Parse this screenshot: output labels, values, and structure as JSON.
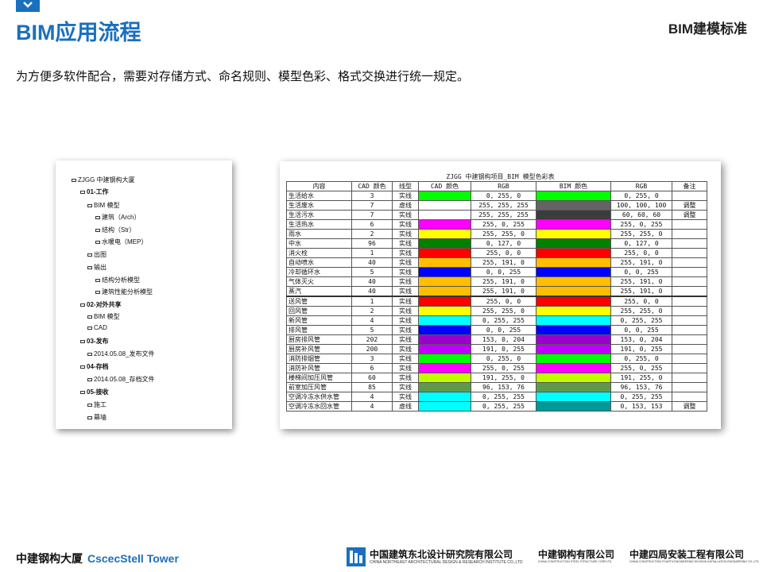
{
  "header": {
    "title": "BIM应用流程",
    "right_label": "BIM建模标准",
    "accent_color": "#1a6fbf"
  },
  "subtitle": "为方便多软件配合，需要对存储方式、命名规则、模型色彩、格式交换进行统一规定。",
  "folder_tree": [
    {
      "label": "ZJGG 中建钢构大厦",
      "bold": true
    },
    {
      "label": "01-工作",
      "bold": true
    },
    {
      "label": "BIM 模型",
      "bold": false
    },
    {
      "label": "建筑（Arch）",
      "bold": false
    },
    {
      "label": "结构（Str）",
      "bold": false
    },
    {
      "label": "水暖电（MEP）",
      "bold": false
    },
    {
      "label": "出图",
      "bold": false
    },
    {
      "label": "输出",
      "bold": false
    },
    {
      "label": "结构分析模型",
      "bold": false
    },
    {
      "label": "建筑性能分析模型",
      "bold": false
    },
    {
      "label": "02-对外共享",
      "bold": true
    },
    {
      "label": "BIM 模型",
      "bold": false
    },
    {
      "label": "CAD",
      "bold": false
    },
    {
      "label": "03-发布",
      "bold": true
    },
    {
      "label": "2014.05.08_发布文件",
      "bold": false
    },
    {
      "label": "04-存档",
      "bold": true
    },
    {
      "label": "2014.05.08_存档文件",
      "bold": false
    },
    {
      "label": "05-接收",
      "bold": true
    },
    {
      "label": "施工",
      "bold": false
    },
    {
      "label": "幕墙",
      "bold": false
    }
  ],
  "color_table": {
    "caption": "ZJGG 中建钢构项目_BIM 模型色彩表",
    "headers": [
      "内容",
      "CAD 颜色",
      "线型",
      "CAD 颜色",
      "RGB",
      "BIM 颜色",
      "RGB",
      "备注"
    ],
    "rows": [
      {
        "name": "生活给水",
        "cad": "3",
        "line": "实线",
        "cad_color": "#00ff00",
        "rgb1": "0, 255, 0",
        "bim_color": "#00ff00",
        "rgb2": "0, 255, 0",
        "note": ""
      },
      {
        "name": "生活废水",
        "cad": "7",
        "line": "虚线",
        "cad_color": "#ffffff",
        "rgb1": "255, 255, 255",
        "bim_color": "#646464",
        "rgb2": "100, 100, 100",
        "note": "调整"
      },
      {
        "name": "生活污水",
        "cad": "7",
        "line": "实线",
        "cad_color": "#ffffff",
        "rgb1": "255, 255, 255",
        "bim_color": "#3c3c3c",
        "rgb2": "60, 60, 60",
        "note": "调整"
      },
      {
        "name": "生活热水",
        "cad": "6",
        "line": "实线",
        "cad_color": "#ff00ff",
        "rgb1": "255, 0, 255",
        "bim_color": "#ff00ff",
        "rgb2": "255, 0, 255",
        "note": ""
      },
      {
        "name": "雨水",
        "cad": "2",
        "line": "实线",
        "cad_color": "#ffff00",
        "rgb1": "255, 255, 0",
        "bim_color": "#ffff00",
        "rgb2": "255, 255, 0",
        "note": ""
      },
      {
        "name": "中水",
        "cad": "96",
        "line": "实线",
        "cad_color": "#007f00",
        "rgb1": "0, 127, 0",
        "bim_color": "#007f00",
        "rgb2": "0, 127, 0",
        "note": ""
      },
      {
        "name": "消火栓",
        "cad": "1",
        "line": "实线",
        "cad_color": "#ff0000",
        "rgb1": "255, 0, 0",
        "bim_color": "#ff0000",
        "rgb2": "255, 0, 0",
        "note": ""
      },
      {
        "name": "自动喷水",
        "cad": "40",
        "line": "实线",
        "cad_color": "#ffbf00",
        "rgb1": "255, 191, 0",
        "bim_color": "#ffbf00",
        "rgb2": "255, 191, 0",
        "note": ""
      },
      {
        "name": "冷却循环水",
        "cad": "5",
        "line": "实线",
        "cad_color": "#0000ff",
        "rgb1": "0, 0, 255",
        "bim_color": "#0000ff",
        "rgb2": "0, 0, 255",
        "note": ""
      },
      {
        "name": "气体灭火",
        "cad": "40",
        "line": "实线",
        "cad_color": "#ffbf00",
        "rgb1": "255, 191, 0",
        "bim_color": "#ffbf00",
        "rgb2": "255, 191, 0",
        "note": ""
      },
      {
        "name": "蒸汽",
        "cad": "40",
        "line": "实线",
        "cad_color": "#ffbf00",
        "rgb1": "255, 191, 0",
        "bim_color": "#ffbf00",
        "rgb2": "255, 191, 0",
        "note": ""
      },
      {
        "name": "送风管",
        "cad": "1",
        "line": "实线",
        "cad_color": "#ff0000",
        "rgb1": "255, 0, 0",
        "bim_color": "#ff0000",
        "rgb2": "255, 0, 0",
        "note": ""
      },
      {
        "name": "回风管",
        "cad": "2",
        "line": "实线",
        "cad_color": "#ffff00",
        "rgb1": "255, 255, 0",
        "bim_color": "#ffff00",
        "rgb2": "255, 255, 0",
        "note": ""
      },
      {
        "name": "新风管",
        "cad": "4",
        "line": "实线",
        "cad_color": "#00ffff",
        "rgb1": "0, 255, 255",
        "bim_color": "#00ffff",
        "rgb2": "0, 255, 255",
        "note": ""
      },
      {
        "name": "排风管",
        "cad": "5",
        "line": "实线",
        "cad_color": "#0000ff",
        "rgb1": "0, 0, 255",
        "bim_color": "#0000ff",
        "rgb2": "0, 0, 255",
        "note": ""
      },
      {
        "name": "厨房排风管",
        "cad": "202",
        "line": "实线",
        "cad_color": "#9900cc",
        "rgb1": "153, 0, 204",
        "bim_color": "#9900cc",
        "rgb2": "153, 0, 204",
        "note": ""
      },
      {
        "name": "厨房补风管",
        "cad": "200",
        "line": "实线",
        "cad_color": "#bf00ff",
        "rgb1": "191, 0, 255",
        "bim_color": "#bf00ff",
        "rgb2": "191, 0, 255",
        "note": ""
      },
      {
        "name": "消防排烟管",
        "cad": "3",
        "line": "实线",
        "cad_color": "#00ff00",
        "rgb1": "0, 255, 0",
        "bim_color": "#00ff00",
        "rgb2": "0, 255, 0",
        "note": ""
      },
      {
        "name": "消防补风管",
        "cad": "6",
        "line": "实线",
        "cad_color": "#ff00ff",
        "rgb1": "255, 0, 255",
        "bim_color": "#ff00ff",
        "rgb2": "255, 0, 255",
        "note": ""
      },
      {
        "name": "楼梯间加压风管",
        "cad": "60",
        "line": "实线",
        "cad_color": "#bfff00",
        "rgb1": "191, 255, 0",
        "bim_color": "#bfff00",
        "rgb2": "191, 255, 0",
        "note": ""
      },
      {
        "name": "前室加压风管",
        "cad": "85",
        "line": "实线",
        "cad_color": "#60994c",
        "rgb1": "96, 153, 76",
        "bim_color": "#60994c",
        "rgb2": "96, 153, 76",
        "note": ""
      },
      {
        "name": "空调冷冻水供水管",
        "cad": "4",
        "line": "实线",
        "cad_color": "#00ffff",
        "rgb1": "0, 255, 255",
        "bim_color": "#00ffff",
        "rgb2": "0, 255, 255",
        "note": ""
      },
      {
        "name": "空调冷冻水回水管",
        "cad": "4",
        "line": "虚线",
        "cad_color": "#00ffff",
        "rgb1": "0, 255, 255",
        "bim_color": "#009999",
        "rgb2": "0, 153, 153",
        "note": "调整"
      }
    ]
  },
  "footer": {
    "project_cn": "中建钢构大厦",
    "project_en": "CscecStell Tower",
    "org1_cn": "中国建筑东北设计研究院有限公司",
    "org1_en": "CHINA NORTHEAST ARCHITECTURAL DESIGN & RESEARCH INSTITUTE CO.,LTD",
    "org2_cn": "中建钢构有限公司",
    "org2_en": "CHINA CONSTRUCTION STEEL STRUCTURE CORP.LTD.",
    "org3_cn": "中建四局安装工程有限公司",
    "org3_en": "CHINA CONSTRUCTION FOURTH ENGINEERING DIVISION INSTALLATION ENGINEERING CO.,LTD"
  }
}
